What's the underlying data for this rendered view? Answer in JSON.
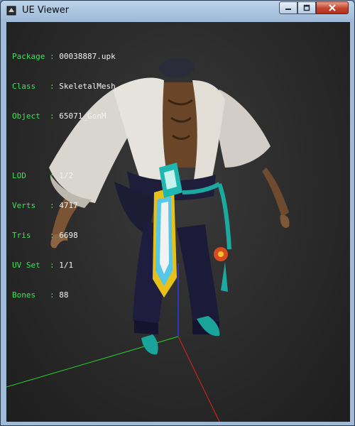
{
  "window": {
    "title": "UE Viewer"
  },
  "info": [
    {
      "label": "Package : ",
      "value": "00038887.upk"
    },
    {
      "label": "Class   : ",
      "value": "SkeletalMesh"
    },
    {
      "label": "Object  : ",
      "value": "65071_GonM"
    }
  ],
  "stats": [
    {
      "label": "LOD     : ",
      "value": "1/2"
    },
    {
      "label": "Verts   : ",
      "value": "4717"
    },
    {
      "label": "Tris    : ",
      "value": "6698"
    },
    {
      "label": "UV Set  : ",
      "value": "1/1"
    },
    {
      "label": "Bones   : ",
      "value": "88"
    }
  ],
  "axes": {
    "x_color": "#e0241c",
    "y_color": "#24d62c",
    "z_color": "#2a3cf0"
  },
  "icons": [
    "app-icon",
    "minimize-icon",
    "maximize-icon",
    "close-icon"
  ]
}
